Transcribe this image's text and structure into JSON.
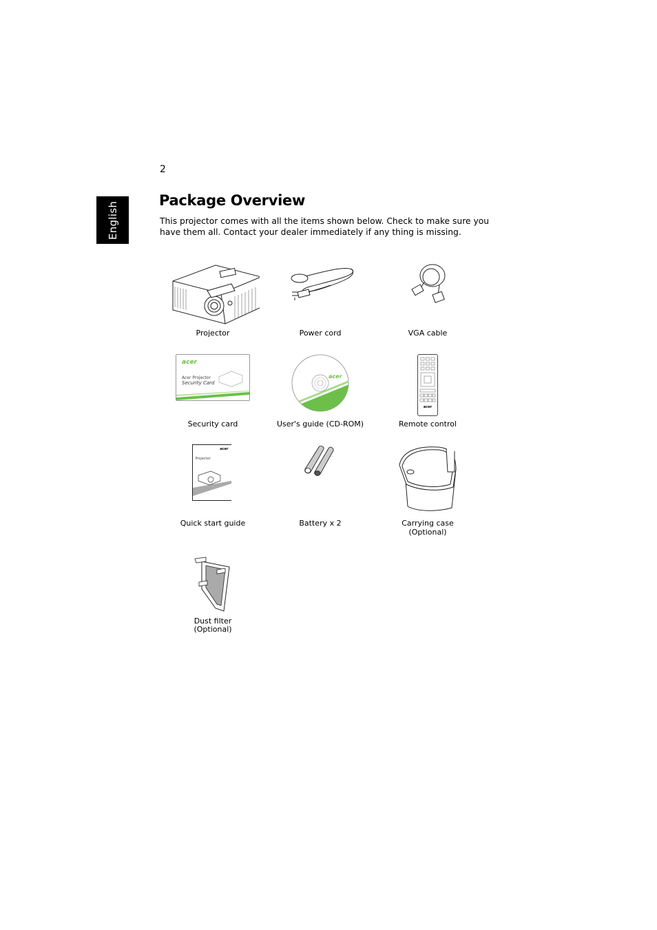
{
  "page": {
    "number": "2",
    "language_tab": "English",
    "title": "Package Overview",
    "intro": "This projector comes with all the items shown below. Check to make sure you have them all. Contact your dealer immediately if any thing is missing."
  },
  "items": [
    {
      "label": "Projector",
      "icon": "projector-icon"
    },
    {
      "label": "Power cord",
      "icon": "power-cord-icon"
    },
    {
      "label": "VGA cable",
      "icon": "vga-cable-icon"
    },
    {
      "label": "Security card",
      "icon": "security-card-icon",
      "card_brand": "acer",
      "card_line1": "Acer Projector",
      "card_line2": "Security Card"
    },
    {
      "label": "User's guide (CD-ROM)",
      "icon": "cd-rom-icon",
      "disc_brand": "acer"
    },
    {
      "label": "Remote control",
      "icon": "remote-control-icon",
      "remote_brand": "acer"
    },
    {
      "label": "Quick start guide",
      "icon": "quick-start-guide-icon",
      "guide_brand": "acer",
      "guide_title": "Projector"
    },
    {
      "label": "Battery x 2",
      "icon": "battery-icon"
    },
    {
      "label": "Carrying case",
      "sublabel": "(Optional)",
      "icon": "carrying-case-icon"
    },
    {
      "label": "Dust filter",
      "sublabel": "(Optional)",
      "icon": "dust-filter-icon"
    }
  ],
  "colors": {
    "brand_green": "#6cc04a",
    "tab_background": "#000000",
    "tab_text": "#ffffff"
  }
}
